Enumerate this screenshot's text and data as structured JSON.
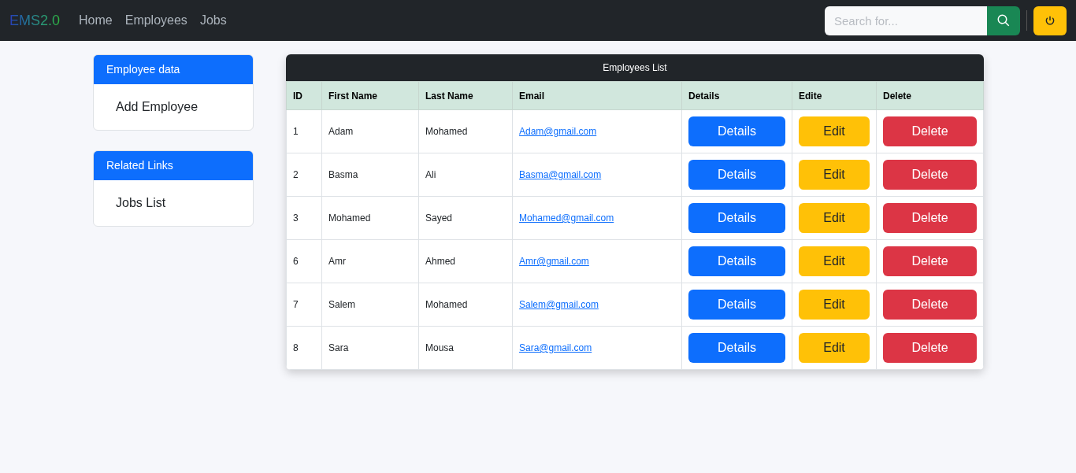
{
  "navbar": {
    "brand": "EMS2.0",
    "links": [
      {
        "label": "Home"
      },
      {
        "label": "Employees"
      },
      {
        "label": "Jobs"
      }
    ],
    "search": {
      "placeholder": "Search for..."
    }
  },
  "sidebar": [
    {
      "title": "Employee data",
      "items": [
        "Add Employee"
      ]
    },
    {
      "title": "Related Links",
      "items": [
        "Jobs List"
      ]
    }
  ],
  "table": {
    "title": "Employees List",
    "columns": [
      "ID",
      "First Name",
      "Last Name",
      "Email",
      "Details",
      "Edite",
      "Delete"
    ],
    "rows": [
      {
        "id": "1",
        "first": "Adam",
        "last": "Mohamed",
        "email": "Adam@gmail.com",
        "details": "Details",
        "edit": "Edit",
        "delete": "Delete"
      },
      {
        "id": "2",
        "first": "Basma",
        "last": "Ali",
        "email": "Basma@gmail.com",
        "details": "Details",
        "edit": "Edit",
        "delete": "Delete"
      },
      {
        "id": "3",
        "first": "Mohamed",
        "last": "Sayed",
        "email": "Mohamed@gmail.com",
        "details": "Details",
        "edit": "Edit",
        "delete": "Delete"
      },
      {
        "id": "6",
        "first": "Amr",
        "last": "Ahmed",
        "email": "Amr@gmail.com",
        "details": "Details",
        "edit": "Edit",
        "delete": "Delete"
      },
      {
        "id": "7",
        "first": "Salem",
        "last": "Mohamed",
        "email": "Salem@gmail.com",
        "details": "Details",
        "edit": "Edit",
        "delete": "Delete"
      },
      {
        "id": "8",
        "first": "Sara",
        "last": "Mousa",
        "email": "Sara@gmail.com",
        "details": "Details",
        "edit": "Edit",
        "delete": "Delete"
      }
    ]
  }
}
